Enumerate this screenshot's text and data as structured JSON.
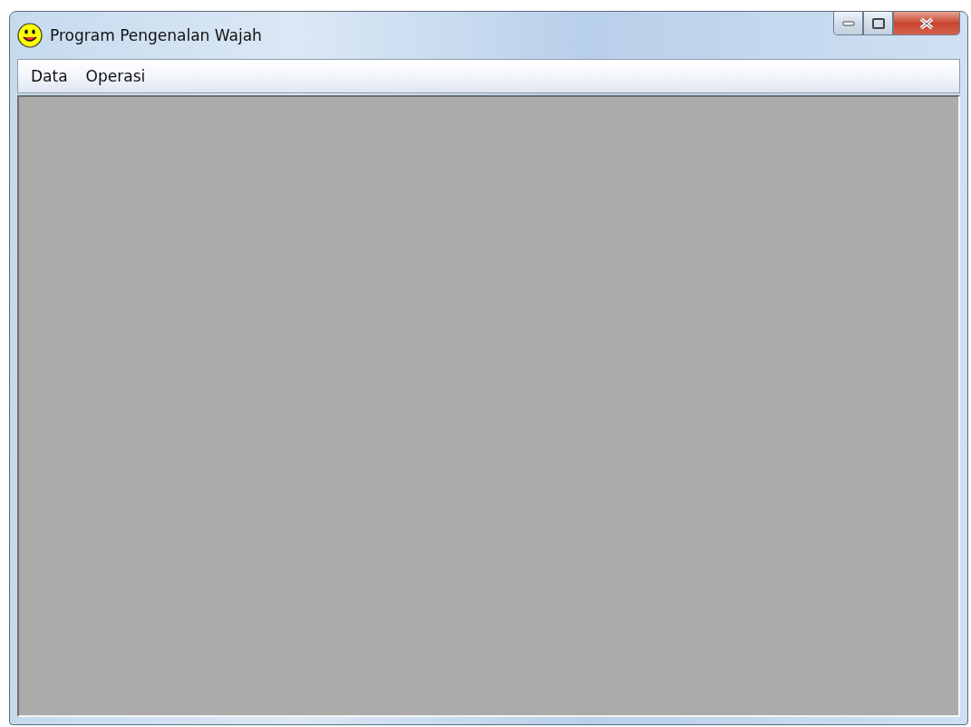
{
  "window": {
    "title": "Program Pengenalan Wajah"
  },
  "menu": [
    "Data",
    "Operasi"
  ]
}
